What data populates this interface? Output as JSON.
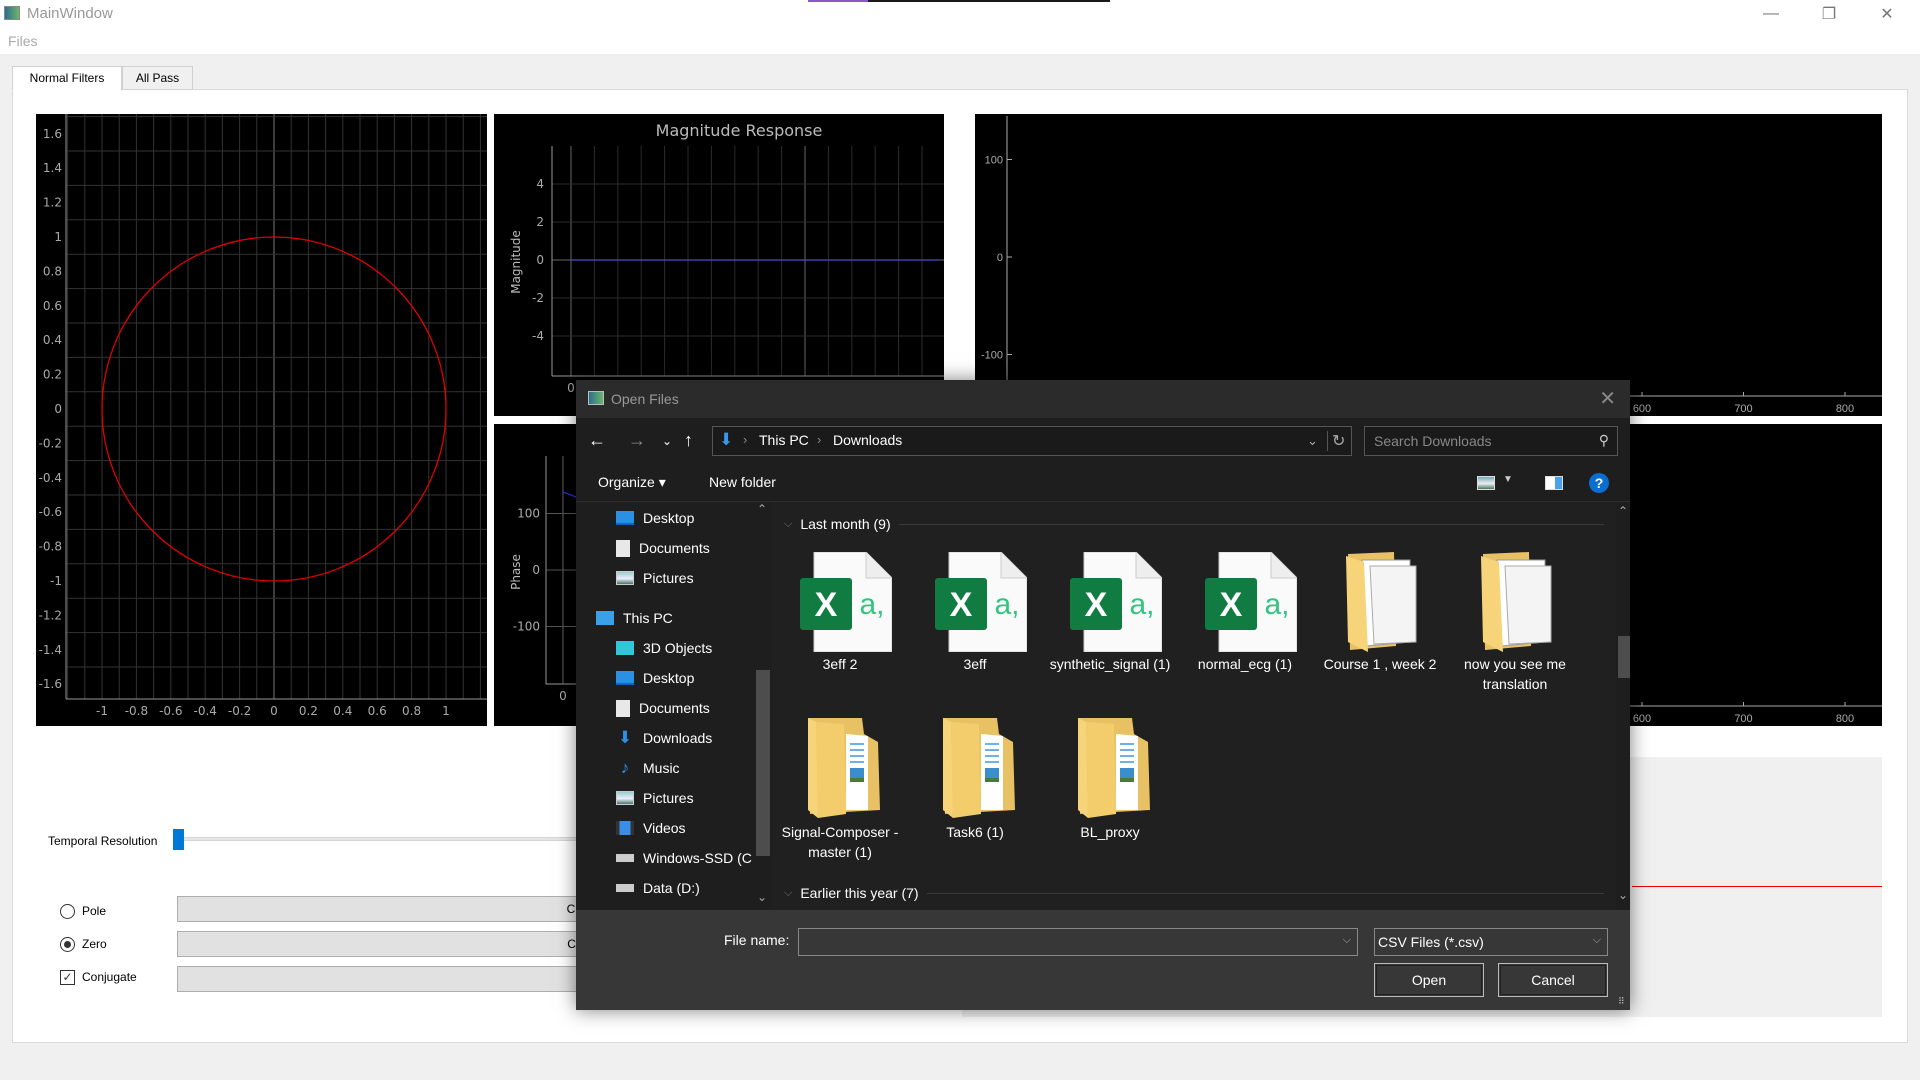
{
  "window": {
    "title": "MainWindow",
    "menu": [
      "Files"
    ],
    "controls": {
      "minimize": "minimize-icon",
      "restore": "restore-icon",
      "close": "close-icon"
    }
  },
  "tabs": [
    {
      "label": "Normal Filters",
      "active": true
    },
    {
      "label": "All Pass",
      "active": false
    }
  ],
  "zplane": {
    "yticks": [
      "1.6",
      "1.4",
      "1.2",
      "1",
      "0.8",
      "0.6",
      "0.4",
      "0.2",
      "0",
      "-0.2",
      "-0.4",
      "-0.6",
      "-0.8",
      "-1",
      "-1.2",
      "-1.4",
      "-1.6"
    ],
    "xticks": [
      "-1",
      "-0.8",
      "-0.6",
      "-0.4",
      "-0.2",
      "0",
      "0.2",
      "0.4",
      "0.6",
      "0.8",
      "1"
    ],
    "circle_color": "#e00000"
  },
  "magnitude": {
    "title": "Magnitude Response",
    "ylabel": "Magnitude",
    "yticks": [
      "4",
      "2",
      "0",
      "-2",
      "-4"
    ],
    "xticks": [
      "0"
    ],
    "line_color": "#4b4bd6"
  },
  "phase": {
    "ylabel": "Phase",
    "yticks": [
      "100",
      "0",
      "-100"
    ],
    "xticks": [
      "0"
    ]
  },
  "signal_top": {
    "yticks": [
      "100",
      "0",
      "-100"
    ],
    "xticks": [
      "600",
      "700",
      "800"
    ]
  },
  "signal_bottom": {
    "xticks": [
      "600",
      "700",
      "800"
    ]
  },
  "controls": {
    "slider_label": "Temporal Resolution",
    "slider_value": 0,
    "radios": [
      {
        "label": "Pole",
        "checked": false
      },
      {
        "label": "Zero",
        "checked": true
      }
    ],
    "checkbox": {
      "label": "Conjugate",
      "checked": true,
      "glyph": "✓"
    },
    "buttons": [
      "Clear zeros",
      "Clear poles",
      "Clear all"
    ]
  },
  "dialog": {
    "title": "Open Files",
    "breadcrumb": [
      "This PC",
      "Downloads"
    ],
    "search_placeholder": "Search Downloads",
    "organize": "Organize ▾",
    "new_folder": "New folder",
    "nav_items": [
      {
        "label": "Desktop",
        "icon": "desktop-icon",
        "indent": 1
      },
      {
        "label": "Documents",
        "icon": "documents-icon",
        "indent": 1
      },
      {
        "label": "Pictures",
        "icon": "pictures-icon",
        "indent": 1
      },
      {
        "label": "This PC",
        "icon": "this-pc-icon",
        "indent": 0
      },
      {
        "label": "3D Objects",
        "icon": "3d-objects-icon",
        "indent": 1
      },
      {
        "label": "Desktop",
        "icon": "desktop-icon",
        "indent": 1
      },
      {
        "label": "Documents",
        "icon": "documents-icon",
        "indent": 1
      },
      {
        "label": "Downloads",
        "icon": "downloads-icon",
        "indent": 1
      },
      {
        "label": "Music",
        "icon": "music-icon",
        "indent": 1
      },
      {
        "label": "Pictures",
        "icon": "pictures-icon",
        "indent": 1
      },
      {
        "label": "Videos",
        "icon": "videos-icon",
        "indent": 1
      },
      {
        "label": "Windows-SSD (C",
        "icon": "drive-c-icon",
        "indent": 1
      },
      {
        "label": "Data (D:)",
        "icon": "drive-d-icon",
        "indent": 1
      }
    ],
    "groups": [
      {
        "label": "Last month (9)"
      },
      {
        "label": "Earlier this year (7)"
      }
    ],
    "files": [
      {
        "name": "3eff 2",
        "type": "csv"
      },
      {
        "name": "3eff",
        "type": "csv"
      },
      {
        "name": "synthetic_signal (1)",
        "type": "csv"
      },
      {
        "name": "normal_ecg (1)",
        "type": "csv"
      },
      {
        "name": "Course 1 , week 2",
        "type": "folder"
      },
      {
        "name": "now you see me translation",
        "type": "folder"
      },
      {
        "name": "Signal-Composer -master (1)",
        "type": "folder-docs"
      },
      {
        "name": "Task6 (1)",
        "type": "folder-docs"
      },
      {
        "name": "BL_proxy",
        "type": "folder-docs"
      }
    ],
    "filename_label": "File name:",
    "filename_value": "",
    "filter_value": "CSV Files (*.csv)",
    "open_label": "Open",
    "cancel_label": "Cancel"
  }
}
